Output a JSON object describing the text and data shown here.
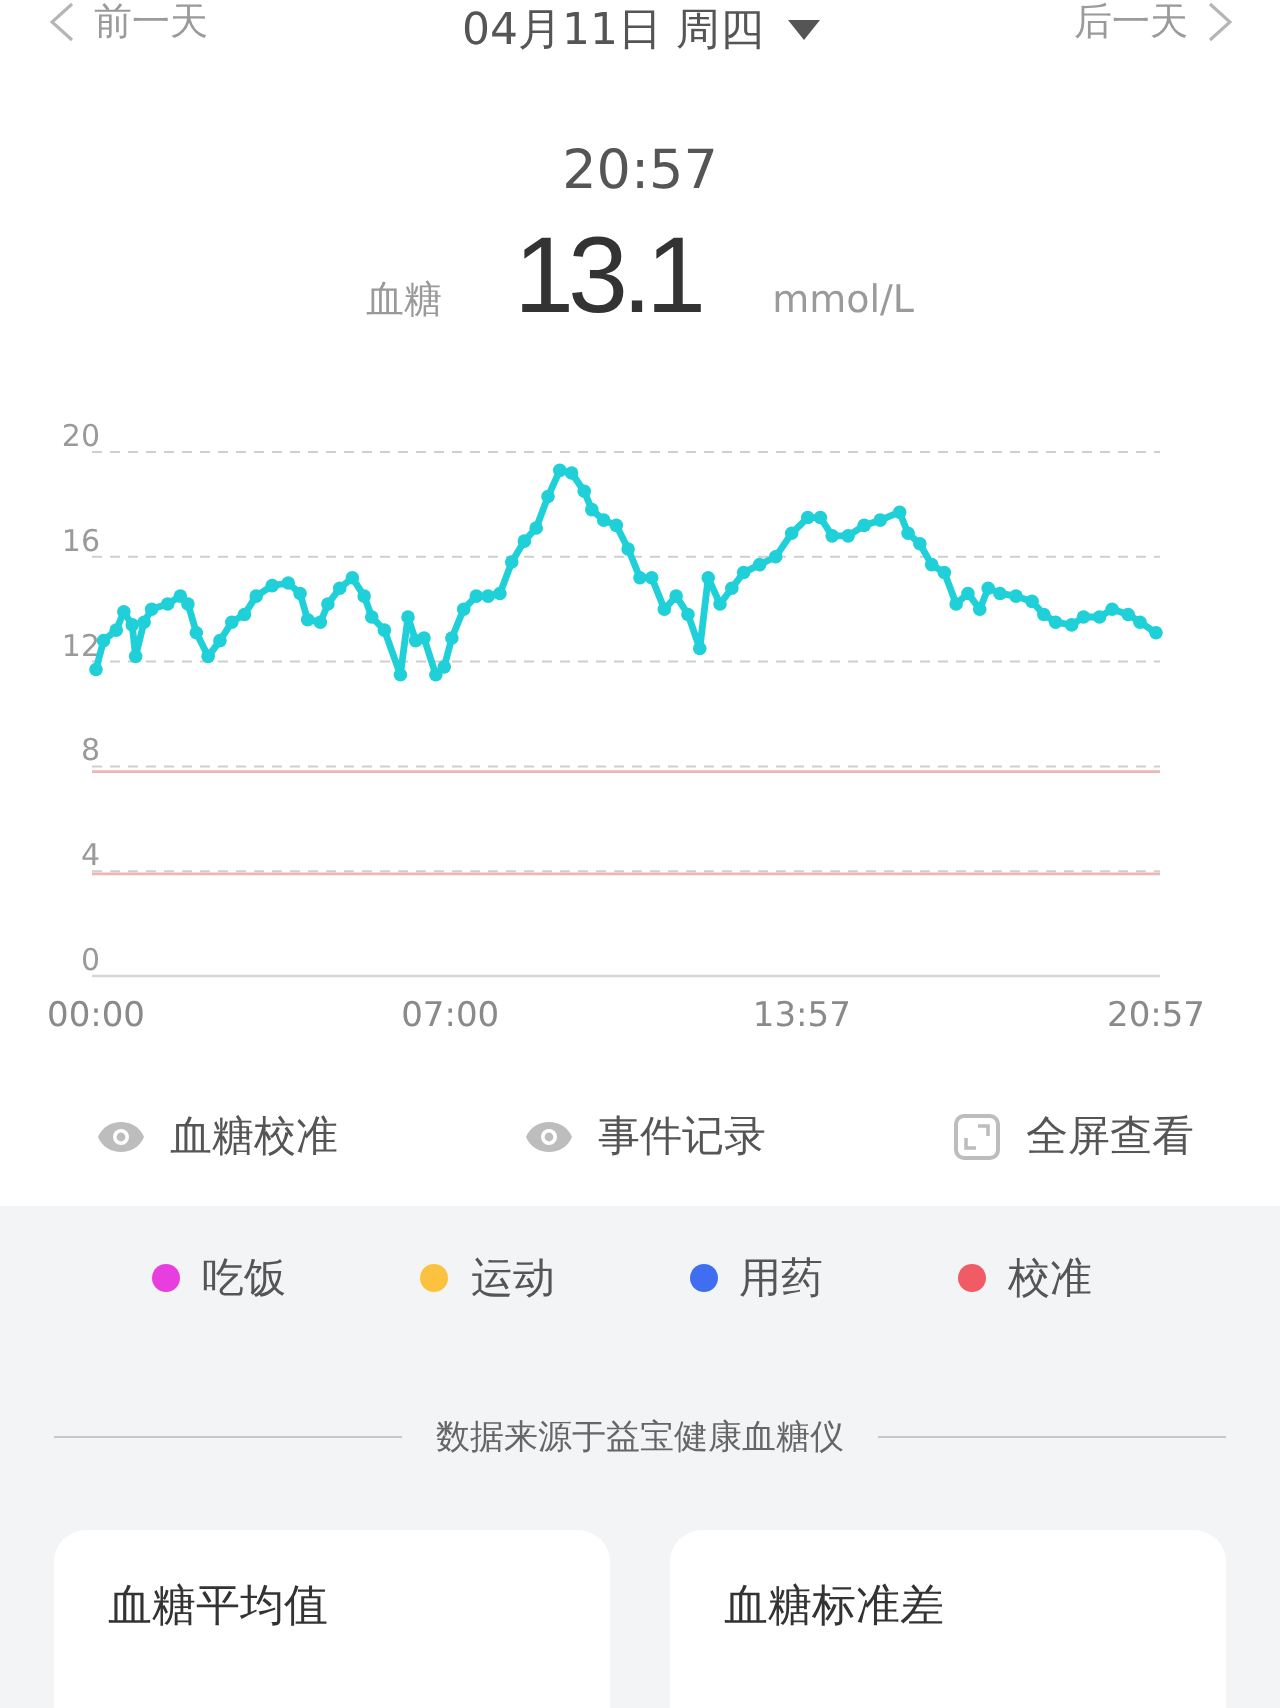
{
  "nav": {
    "prev": {
      "label": "前一天"
    },
    "date": {
      "label": "04月11日 周四"
    },
    "next": {
      "label": "后一天"
    }
  },
  "reading": {
    "time": "20:57",
    "label": "血糖",
    "value": "13.1",
    "unit": "mmol/L"
  },
  "chart": {
    "chart_data": {
      "type": "line",
      "grid": true,
      "x": [
        0,
        9,
        24,
        33,
        43,
        47,
        57,
        66,
        85,
        100,
        109,
        119,
        133,
        147,
        161,
        176,
        190,
        209,
        228,
        242,
        251,
        266,
        275,
        289,
        304,
        318,
        327,
        342,
        361,
        370,
        379,
        389,
        403,
        413,
        422,
        436,
        451,
        465,
        479,
        493,
        508,
        522,
        536,
        550,
        564,
        579,
        588,
        602,
        617,
        631,
        645,
        659,
        674,
        688,
        702,
        716,
        726,
        740,
        754,
        768,
        787,
        806,
        825,
        844,
        859,
        873,
        892,
        911,
        930,
        953,
        963,
        977,
        991,
        1006,
        1020,
        1034,
        1048,
        1058,
        1072,
        1091,
        1110,
        1124,
        1138,
        1157,
        1171,
        1190,
        1205,
        1224,
        1238,
        1257
      ],
      "series": [
        {
          "color": "#1fd0d8",
          "marker": "o",
          "values": [
            11.7,
            12.8,
            13.2,
            13.9,
            13.4,
            12.2,
            13.5,
            14.0,
            14.2,
            14.5,
            14.2,
            13.1,
            12.2,
            12.8,
            13.5,
            13.8,
            14.5,
            14.9,
            15.0,
            14.6,
            13.6,
            13.5,
            14.2,
            14.8,
            15.2,
            14.5,
            13.7,
            13.2,
            11.5,
            13.7,
            12.8,
            12.9,
            11.5,
            11.8,
            12.9,
            14.0,
            14.5,
            14.5,
            14.6,
            15.8,
            16.6,
            17.1,
            18.3,
            19.3,
            19.2,
            18.5,
            17.8,
            17.4,
            17.2,
            16.3,
            15.2,
            15.2,
            14.0,
            14.5,
            13.8,
            12.5,
            15.2,
            14.2,
            14.8,
            15.4,
            15.7,
            16.0,
            16.9,
            17.5,
            17.5,
            16.8,
            16.8,
            17.2,
            17.4,
            17.7,
            16.9,
            16.5,
            15.7,
            15.4,
            14.2,
            14.6,
            14.0,
            14.8,
            14.6,
            14.5,
            14.3,
            13.8,
            13.5,
            13.4,
            13.7,
            13.7,
            14.0,
            13.8,
            13.5,
            13.1
          ]
        }
      ],
      "xlim": [
        0,
        1257
      ],
      "ylim": [
        0,
        20
      ],
      "xticks": [
        {
          "value": 0,
          "label": "00:00"
        },
        {
          "value": 420,
          "label": "07:00"
        },
        {
          "value": 837,
          "label": "13:57"
        },
        {
          "value": 1257,
          "label": "20:57"
        }
      ],
      "yticks": [
        0,
        4,
        8,
        12,
        16,
        20
      ],
      "ref_lines": [
        {
          "axis": "y",
          "value": 7.8,
          "color": "#efb4b4"
        },
        {
          "axis": "y",
          "value": 3.9,
          "color": "#efb4b4"
        }
      ]
    }
  },
  "actions": [
    {
      "kind": "eye",
      "label": "血糖校准"
    },
    {
      "kind": "eye",
      "label": "事件记录"
    },
    {
      "kind": "fullscreen",
      "label": "全屏查看"
    }
  ],
  "legend": [
    {
      "label": "吃饭",
      "color": "#e83ee0"
    },
    {
      "label": "运动",
      "color": "#fbc23f"
    },
    {
      "label": "用药",
      "color": "#3f6ff0"
    },
    {
      "label": "校准",
      "color": "#f05b66"
    }
  ],
  "source_note": "数据来源于益宝健康血糖仪",
  "stats": [
    {
      "title": "血糖平均值"
    },
    {
      "title": "血糖标准差"
    }
  ]
}
